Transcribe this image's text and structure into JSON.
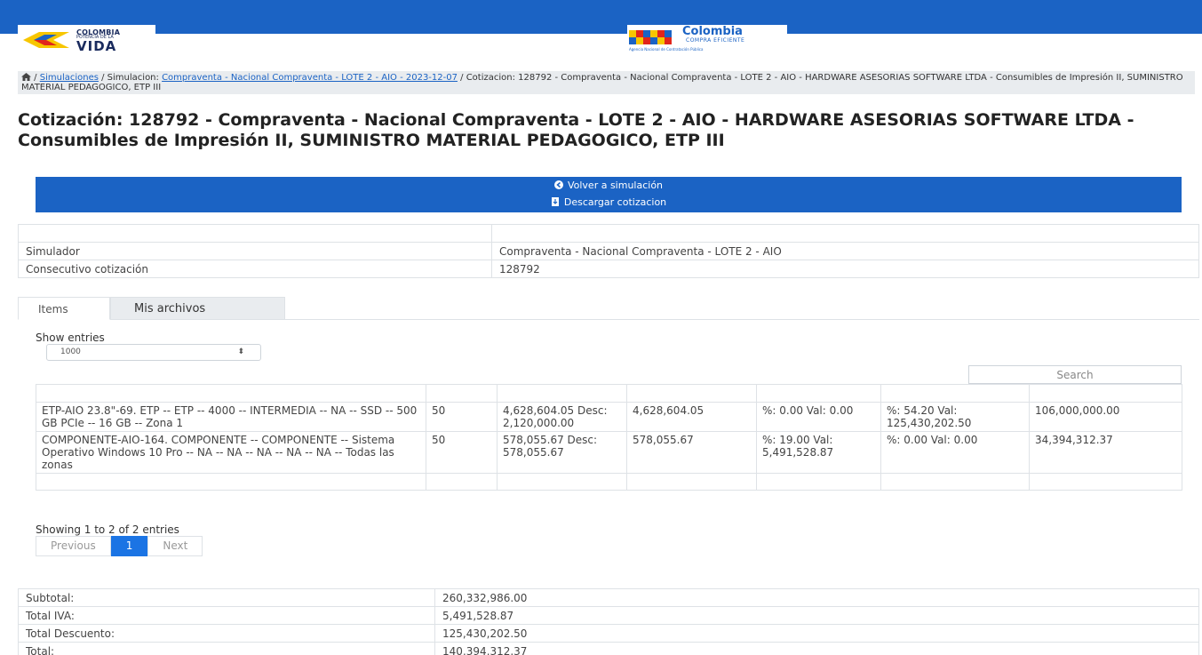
{
  "header": {
    "left_logo": {
      "line1": "COLOMBIA",
      "line2": "POTENCIA DE LA",
      "line3": "VIDA"
    },
    "center_logo": {
      "title": "Colombia",
      "subtitle": "COMPRA EFICIENTE",
      "tagline": "Agencia Nacional de Contratación Pública"
    }
  },
  "breadcrumb": {
    "sep1": " / ",
    "link1": "Simulaciones",
    "mid": " / Simulacion: ",
    "link2": "Compraventa - Nacional Compraventa - LOTE 2 - AIO - 2023-12-07",
    "tail": " / Cotizacion: 128792 - Compraventa - Nacional Compraventa - LOTE 2 - AIO - HARDWARE ASESORIAS SOFTWARE LTDA - Consumibles de Impresión II, SUMINISTRO MATERIAL PEDAGOGICO, ETP III"
  },
  "page_title": "Cotización: 128792 - Compraventa - Nacional Compraventa - LOTE 2 - AIO - HARDWARE ASESORIAS SOFTWARE LTDA - Consumibles de Impresión II, SUMINISTRO MATERIAL PEDAGOGICO, ETP III",
  "actions": {
    "back": "Volver a simulación",
    "download": "Descargar cotizacion"
  },
  "info": {
    "rows": [
      {
        "label": "",
        "value": ""
      },
      {
        "label": "Simulador",
        "value": "Compraventa - Nacional Compraventa - LOTE 2 - AIO"
      },
      {
        "label": "Consecutivo cotización",
        "value": "128792"
      }
    ]
  },
  "tabs": {
    "items": "Items",
    "files": "Mis archivos"
  },
  "datatable": {
    "show_entries": "Show entries",
    "length_value": "1000",
    "search_placeholder": "Search",
    "rows": [
      {
        "description": "ETP-AIO 23.8\"-69. ETP -- ETP -- 4000 -- INTERMEDIA -- NA -- SSD -- 500 GB PCIe -- 16 GB -- Zona 1",
        "quantity": "50",
        "unit_price": "4,628,604.05 Desc: 2,120,000.00",
        "price": "4,628,604.05",
        "iva": "%: 0.00 Val: 0.00",
        "discount": "%: 54.20 Val: 125,430,202.50",
        "total": "106,000,000.00"
      },
      {
        "description": "COMPONENTE-AIO-164. COMPONENTE -- COMPONENTE -- Sistema Operativo Windows 10 Pro -- NA -- NA -- NA -- NA -- NA -- Todas las zonas",
        "quantity": "50",
        "unit_price": "578,055.67 Desc: 578,055.67",
        "price": "578,055.67",
        "iva": "%: 19.00 Val: 5,491,528.87",
        "discount": "%: 0.00 Val: 0.00",
        "total": "34,394,312.37"
      }
    ],
    "showing": "Showing 1 to 2 of 2 entries",
    "pager": {
      "prev": "Previous",
      "current": "1",
      "next": "Next"
    }
  },
  "totals": {
    "rows": [
      {
        "label": "Subtotal:",
        "value": "260,332,986.00"
      },
      {
        "label": "Total IVA:",
        "value": "5,491,528.87"
      },
      {
        "label": "Total Descuento:",
        "value": "125,430,202.50"
      },
      {
        "label": "Total:",
        "value": "140,394,312.37"
      }
    ]
  },
  "colors": {
    "brand_blue": "#1b63c4",
    "pager_active": "#1b74e4",
    "breadcrumb_bg": "#e9ecef"
  }
}
